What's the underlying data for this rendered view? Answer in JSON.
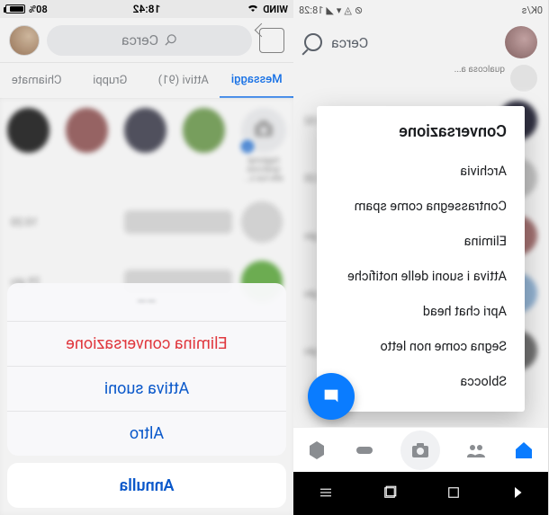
{
  "left": {
    "status": {
      "carrier": "WIND",
      "time": "18:42",
      "battery": "80%"
    },
    "search_placeholder": "Cerca",
    "tabs": {
      "messaggi": "Messaggi",
      "attivi": "Attivi (91)",
      "gruppi": "Gruppi",
      "chiamate": "Chiamate"
    },
    "story_add": {
      "line1": "Aggiungi",
      "line2": "qualcosa",
      "line3": "alla tua s..."
    },
    "chats": [
      {
        "time": "10:20"
      },
      {
        "time": "29 giu"
      }
    ],
    "sheet": {
      "header": "——",
      "delete": "Elimina conversazione",
      "sounds": "Attiva suoni",
      "more": "Altro",
      "cancel": "Annulla"
    }
  },
  "right": {
    "status": {
      "speed": "0K/s",
      "time": "18:28"
    },
    "search_label": "Cerca",
    "story_hint": "qualcosa a...",
    "times": [
      "13:52",
      "10:20",
      "gio",
      "2 giu",
      "7 giu"
    ],
    "dialog": {
      "title": "Conversazione",
      "options": {
        "archive": "Archivia",
        "spam": "Contrassegna come spam",
        "delete": "Elimina",
        "notif": "Attiva i suoni delle notifiche",
        "chathead": "Apri chat head",
        "unread": "Segna come non letto",
        "unblock": "Sblocca"
      }
    },
    "fab": "chat"
  }
}
